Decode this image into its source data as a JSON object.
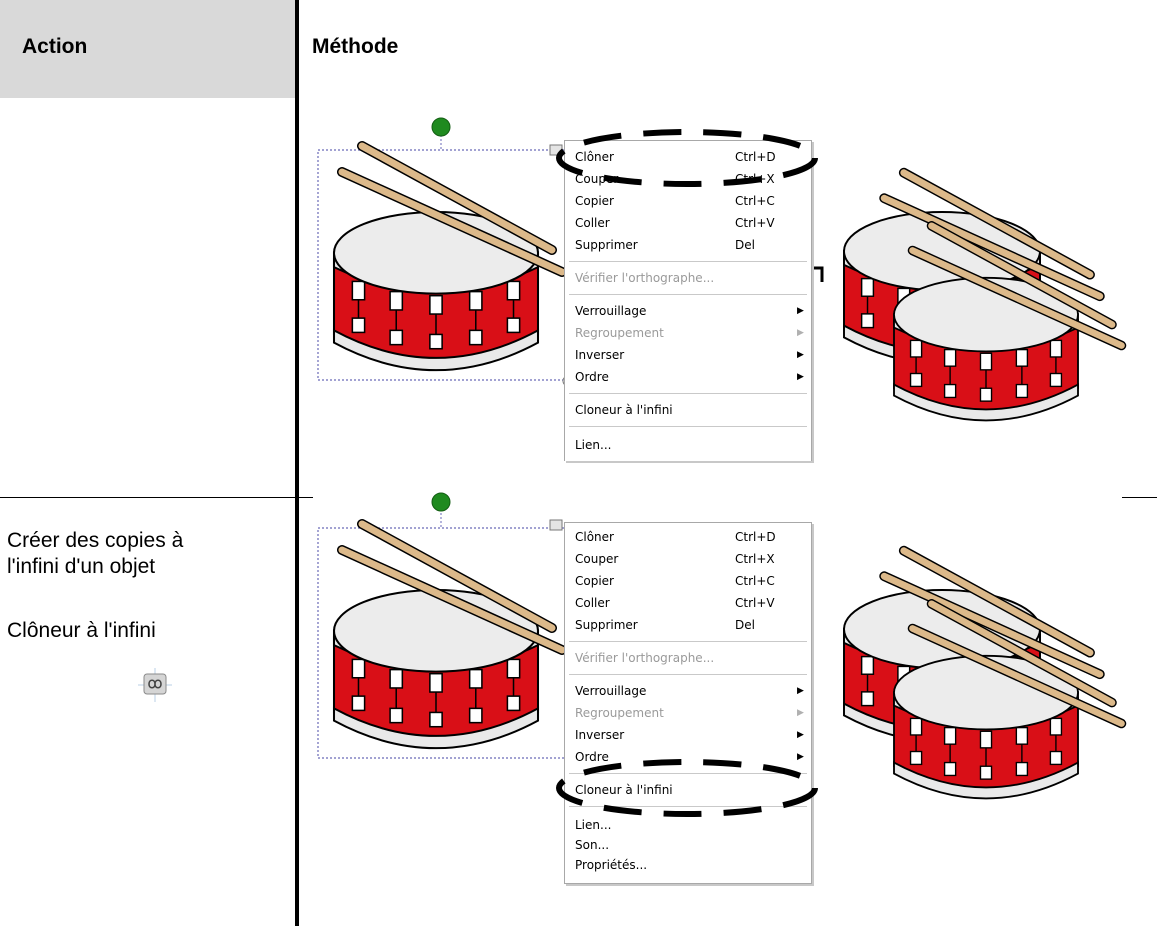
{
  "header": {
    "action": "Action",
    "method": "Méthode"
  },
  "row2": {
    "description": [
      "Créer des copies à",
      "l'infini d'un objet"
    ],
    "tool_name": "Clôneur à l'infini",
    "tool_icon": "infinite-cloner-icon"
  },
  "menu_top": {
    "items": [
      {
        "label": "Clôner",
        "shortcut": "Ctrl+D"
      },
      {
        "label": "Couper",
        "shortcut": "Ctrl+X"
      },
      {
        "label": "Copier",
        "shortcut": "Ctrl+C"
      },
      {
        "label": "Coller",
        "shortcut": "Ctrl+V"
      },
      {
        "label": "Supprimer",
        "shortcut": "Del"
      },
      {
        "label": "Vérifier l'orthographe..."
      },
      {
        "label": "Verrouillage"
      },
      {
        "label": "Regroupement"
      },
      {
        "label": "Inverser"
      },
      {
        "label": "Ordre"
      },
      {
        "label": "Cloneur à l'infini"
      },
      {
        "label": "Lien..."
      }
    ]
  },
  "menu_bottom": {
    "items": [
      {
        "label": "Clôner",
        "shortcut": "Ctrl+D"
      },
      {
        "label": "Couper",
        "shortcut": "Ctrl+X"
      },
      {
        "label": "Copier",
        "shortcut": "Ctrl+C"
      },
      {
        "label": "Coller",
        "shortcut": "Ctrl+V"
      },
      {
        "label": "Supprimer",
        "shortcut": "Del"
      },
      {
        "label": "Vérifier l'orthographe..."
      },
      {
        "label": "Verrouillage"
      },
      {
        "label": "Regroupement"
      },
      {
        "label": "Inverser"
      },
      {
        "label": "Ordre"
      },
      {
        "label": "Cloneur à l'infini"
      },
      {
        "label": "Lien..."
      },
      {
        "label": "Son..."
      },
      {
        "label": "Propriétés..."
      }
    ]
  },
  "colors": {
    "header_bg": "#d9d9d9",
    "drum_red": "#d90f17",
    "stick": "#dcb98a",
    "handle_green": "#1f8a1f"
  }
}
